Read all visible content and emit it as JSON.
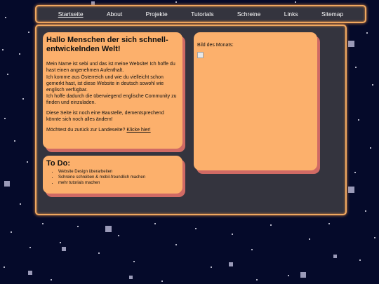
{
  "nav": {
    "items": [
      "Startseite",
      "About",
      "Projekte",
      "Tutorials",
      "Schreine",
      "Links",
      "Sitemap"
    ]
  },
  "intro": {
    "title": "Hallo Menschen der sich schnell-entwickelnden Welt!",
    "p1_line1": "Mein Name ist sebi und das ist meine Website! Ich hoffe du hast einen angenehmen Aufenthalt.",
    "p1_line2": "Ich komme aus Österreich und wie du vielleicht schon gemerkt hast, ist diese Website in deutsch sowohl wie englisch verfügbar.",
    "p1_line3": "Ich hoffe dadurch die überwiegend englische Community zu finden und einzuladen.",
    "p2": "Diese Seite ist noch eine Baustelle, dementsprechend könnte sich noch alles ändern!",
    "p3_text": "Möchtest du zurück zur Landeseite?",
    "p3_link": "Klicke hier!"
  },
  "todo": {
    "title": "To Do:",
    "items": [
      "Website Design überarbeiten",
      "Schreine schreiben & mobil-freundlich machen",
      "mehr tutorials machen"
    ]
  },
  "motm": {
    "label": "Bild des Monats:"
  },
  "colors": {
    "background": "#050a2a",
    "panel": "#34343e",
    "border": "#f0a860",
    "card": "#fcb06c",
    "card_shadow": "#d06a64"
  }
}
